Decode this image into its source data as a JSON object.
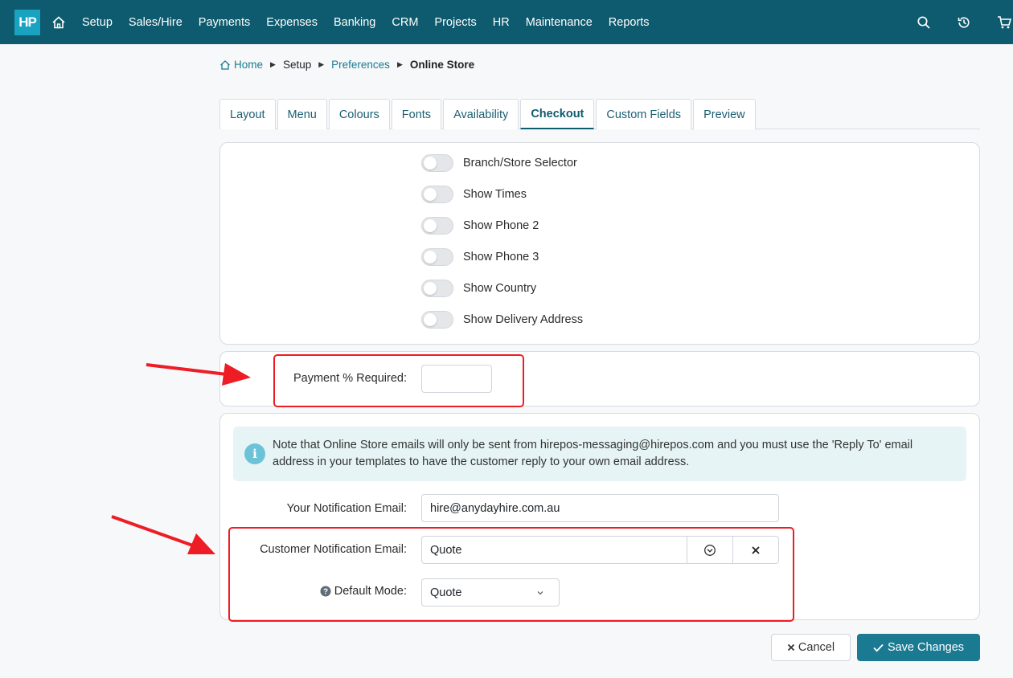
{
  "app": {
    "logo": "HP"
  },
  "nav": {
    "items": [
      "Setup",
      "Sales/Hire",
      "Payments",
      "Expenses",
      "Banking",
      "CRM",
      "Projects",
      "HR",
      "Maintenance",
      "Reports"
    ]
  },
  "breadcrumb": {
    "home": "Home",
    "setup": "Setup",
    "preferences": "Preferences",
    "current": "Online Store"
  },
  "tabs": [
    "Layout",
    "Menu",
    "Colours",
    "Fonts",
    "Availability",
    "Checkout",
    "Custom Fields",
    "Preview"
  ],
  "active_tab": "Checkout",
  "toggles": [
    {
      "label": "Branch/Store Selector",
      "on": false
    },
    {
      "label": "Show Times",
      "on": false
    },
    {
      "label": "Show Phone 2",
      "on": false
    },
    {
      "label": "Show Phone 3",
      "on": false
    },
    {
      "label": "Show Country",
      "on": false
    },
    {
      "label": "Show Delivery Address",
      "on": false
    }
  ],
  "payment": {
    "label": "Payment % Required:",
    "value": ""
  },
  "notice": {
    "text": "Note that Online Store emails will only be sent from hirepos-messaging@hirepos.com and you must use the 'Reply To' email address in your templates to have the customer reply to your own email address."
  },
  "notification_email": {
    "label": "Your Notification Email:",
    "value": "hire@anydayhire.com.au"
  },
  "customer_notification": {
    "label": "Customer Notification Email:",
    "value": "Quote"
  },
  "default_mode": {
    "label": "Default Mode:",
    "value": "Quote"
  },
  "buttons": {
    "cancel": "Cancel",
    "save": "Save Changes"
  },
  "colors": {
    "navbar": "#0e5a6e",
    "accent": "#1a7a92",
    "highlight": "#ee1c25"
  }
}
